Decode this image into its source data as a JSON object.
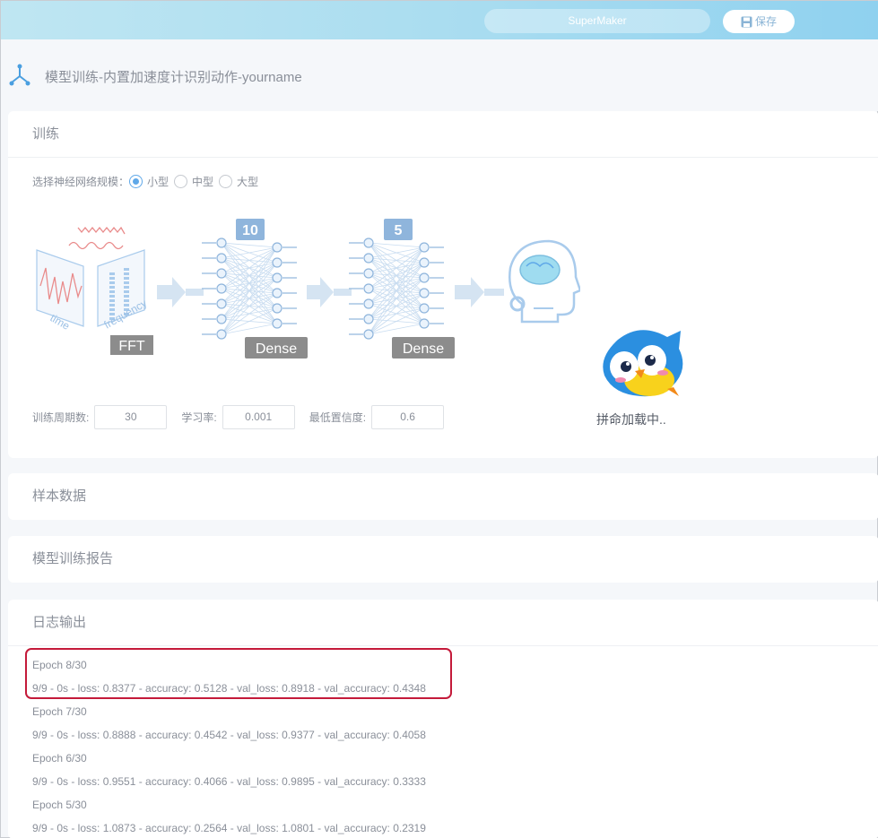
{
  "topbar": {
    "app_name": "SuperMaker",
    "save_label": "保存"
  },
  "page": {
    "title": "模型训练-内置加速度计识别动作-yourname"
  },
  "training": {
    "header": "训练",
    "scale_label": "选择神经网络规模：",
    "scale_options": [
      "小型",
      "中型",
      "大型"
    ],
    "scale_selected": "小型",
    "diagram": {
      "fft_label": "FFT",
      "time_label": "time",
      "frequency_label": "frequency",
      "layer1_units": "10",
      "layer1_label": "Dense",
      "layer2_units": "5",
      "layer2_label": "Dense"
    },
    "params": {
      "epochs_label": "训练周期数:",
      "epochs_value": "30",
      "lr_label": "学习率:",
      "lr_value": "0.001",
      "confidence_label": "最低置信度:",
      "confidence_value": "0.6"
    },
    "loading_text": "拼命加载中.."
  },
  "sections": {
    "sample_data": "样本数据",
    "report": "模型训练报告",
    "log": "日志输出"
  },
  "log_lines": [
    "Epoch 8/30",
    "9/9 - 0s - loss: 0.8377 - accuracy: 0.5128 - val_loss: 0.8918 - val_accuracy: 0.4348",
    "Epoch 7/30",
    "9/9 - 0s - loss: 0.8888 - accuracy: 0.4542 - val_loss: 0.9377 - val_accuracy: 0.4058",
    "Epoch 6/30",
    "9/9 - 0s - loss: 0.9551 - accuracy: 0.4066 - val_loss: 0.9895 - val_accuracy: 0.3333",
    "Epoch 5/30",
    "9/9 - 0s - loss: 1.0873 - accuracy: 0.2564 - val_loss: 1.0801 - val_accuracy: 0.2319"
  ],
  "colors": {
    "accent": "#5fa8e8",
    "highlight": "#c41a3a"
  }
}
